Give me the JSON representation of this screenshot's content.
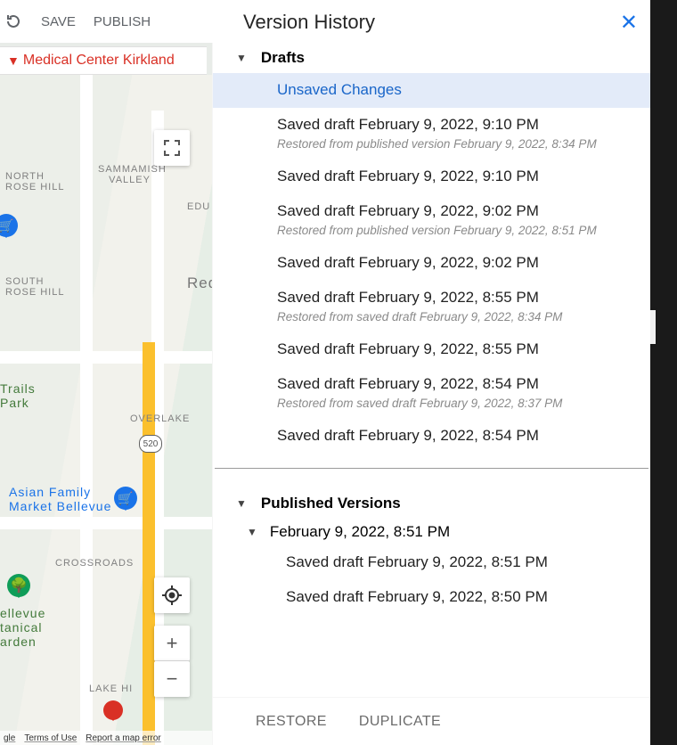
{
  "toolbar": {
    "save": "SAVE",
    "publish": "PUBLISH"
  },
  "banner": "Medical Center Kirkland",
  "map": {
    "labels": {
      "rose": "NORTH\nROSE HILL",
      "sammamish": "SAMMAMISH\n   VALLEY",
      "edu": "EDU",
      "south": "SOUTH\nROSE HILL",
      "redn": "Redn",
      "trails": "Trails\nPark",
      "overlake": "OVERLAKE",
      "crossroads": "CROSSROADS",
      "lake": "LAKE HI",
      "asian": "Asian Family\nMarket Bellevue",
      "bellevue": "ellevue\ntanical\narden"
    },
    "hwy_badge": "520",
    "footer": {
      "gle": "gle",
      "terms": "Terms of Use",
      "report": "Report a map error"
    }
  },
  "panel": {
    "title": "Version History",
    "restore": "RESTORE",
    "duplicate": "DUPLICATE",
    "drafts_label": "Drafts",
    "published_label": "Published Versions",
    "drafts": [
      {
        "label": "Unsaved Changes",
        "selected": true
      },
      {
        "label": "Saved draft February 9, 2022, 9:10 PM",
        "note": "Restored from published version February 9, 2022, 8:34 PM"
      },
      {
        "label": "Saved draft February 9, 2022, 9:10 PM"
      },
      {
        "label": "Saved draft February 9, 2022, 9:02 PM",
        "note": "Restored from published version February 9, 2022, 8:51 PM"
      },
      {
        "label": "Saved draft February 9, 2022, 9:02 PM"
      },
      {
        "label": "Saved draft February 9, 2022, 8:55 PM",
        "note": "Restored from saved draft February 9, 2022, 8:34 PM"
      },
      {
        "label": "Saved draft February 9, 2022, 8:55 PM"
      },
      {
        "label": "Saved draft February 9, 2022, 8:54 PM",
        "note": "Restored from saved draft February 9, 2022, 8:37 PM"
      },
      {
        "label": "Saved draft February 9, 2022, 8:54 PM"
      }
    ],
    "published": [
      {
        "date": "February 9, 2022, 8:51 PM",
        "children": [
          "Saved draft February 9, 2022, 8:51 PM",
          "Saved draft February 9, 2022, 8:50 PM"
        ]
      }
    ]
  }
}
